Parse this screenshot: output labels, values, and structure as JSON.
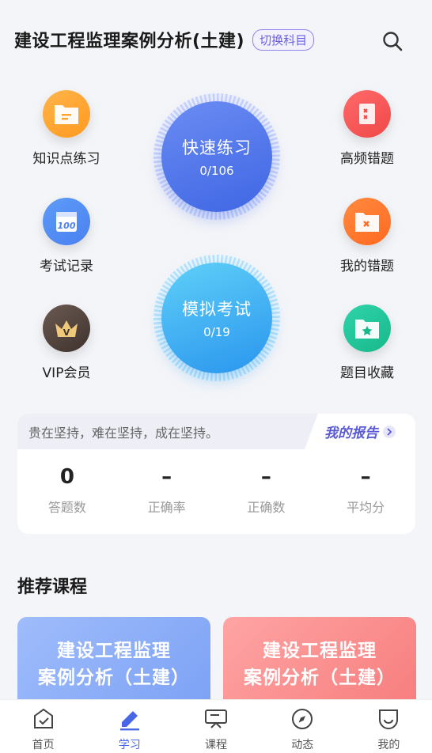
{
  "header": {
    "title": "建设工程监理案例分析(土建)",
    "switch_label": "切换科目"
  },
  "features": {
    "knowledge": "知识点练习",
    "exam_record": "考试记录",
    "vip": "VIP会员",
    "frequent_errors": "高频错题",
    "my_errors": "我的错题",
    "favorites": "题目收藏",
    "vip_badge": "V"
  },
  "quick_practice": {
    "label": "快速练习",
    "progress": "0/106"
  },
  "mock_exam": {
    "label": "模拟考试",
    "progress": "0/19"
  },
  "report": {
    "motto": "贵在坚持，难在坚持，成在坚持。",
    "link": "我的报告",
    "stats": [
      {
        "value": "0",
        "label": "答题数"
      },
      {
        "value": "–",
        "label": "正确率"
      },
      {
        "value": "–",
        "label": "正确数"
      },
      {
        "value": "–",
        "label": "平均分"
      }
    ]
  },
  "recommend": {
    "title": "推荐课程",
    "courses": [
      {
        "line1": "建设工程监理",
        "line2": "案例分析（土建）"
      },
      {
        "line1": "建设工程监理",
        "line2": "案例分析（土建）"
      }
    ]
  },
  "tabs": [
    {
      "label": "首页",
      "icon": "home-icon"
    },
    {
      "label": "学习",
      "icon": "pen-icon"
    },
    {
      "label": "课程",
      "icon": "screen-icon"
    },
    {
      "label": "动态",
      "icon": "compass-icon"
    },
    {
      "label": "我的",
      "icon": "profile-icon"
    }
  ],
  "colors": {
    "accent": "#4a66e8",
    "quick_gradient": [
      "#4c74ea",
      "#6b8cf3"
    ],
    "mock_gradient": [
      "#2aa0f2",
      "#5fd0f8"
    ]
  }
}
